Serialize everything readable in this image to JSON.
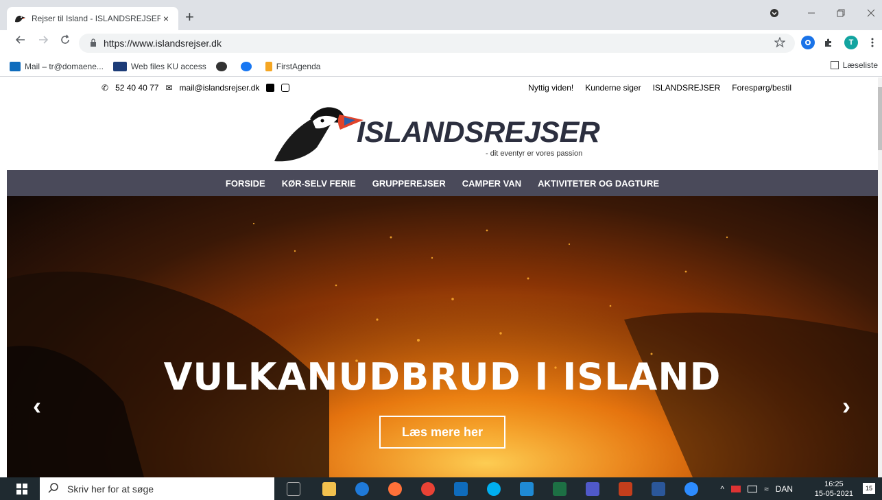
{
  "browser": {
    "tab_title": "Rejser til Island - ISLANDSREJSER",
    "close_glyph": "×",
    "new_tab_glyph": "+",
    "url": "https://www.islandsrejser.dk",
    "profile_initial": "T",
    "reading_list": "Læseliste"
  },
  "bookmarks": [
    {
      "label": "Mail – tr@domaene..."
    },
    {
      "label": "Web files KU access"
    },
    {
      "label": ""
    },
    {
      "label": ""
    },
    {
      "label": "FirstAgenda"
    }
  ],
  "site": {
    "phone": "52 40 40 77",
    "email": "mail@islandsrejser.dk",
    "top_nav": [
      "Nyttig viden!",
      "Kunderne siger",
      "ISLANDSREJSER",
      "Forespørg/bestil"
    ],
    "logo_text": "ISLANDSREJSER",
    "tagline": "- dit eventyr er vores passion",
    "main_nav": [
      "FORSIDE",
      "KØR-SELV FERIE",
      "GRUPPEREJSER",
      "CAMPER VAN",
      "AKTIVITETER OG DAGTURE"
    ],
    "hero_title": "VULKANUDBRUD I ISLAND",
    "hero_button": "Læs mere her"
  },
  "taskbar": {
    "search_placeholder": "Skriv her for at søge",
    "language": "DAN",
    "time": "16:25",
    "date": "15-05-2021",
    "notifications": "15"
  },
  "colors": {
    "nav_bg": "#4a4a5a",
    "taskbar_bg": "#1f2a30",
    "accent": "#1a73e8"
  }
}
